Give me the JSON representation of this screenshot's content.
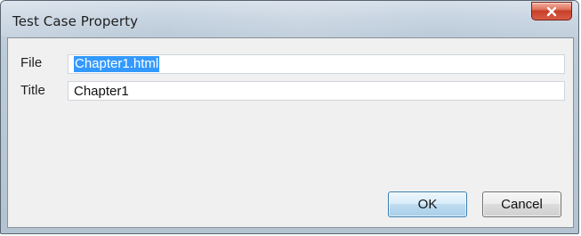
{
  "window": {
    "title": "Test Case Property"
  },
  "form": {
    "file_label": "File",
    "file_value": "Chapter1.html",
    "title_label": "Title",
    "title_value": "Chapter1"
  },
  "buttons": {
    "ok_label": "OK",
    "cancel_label": "Cancel"
  },
  "icons": {
    "close": "close-icon"
  },
  "colors": {
    "selection": "#3399ff",
    "close_button": "#c63d29",
    "ok_border": "#3c7fb1"
  }
}
